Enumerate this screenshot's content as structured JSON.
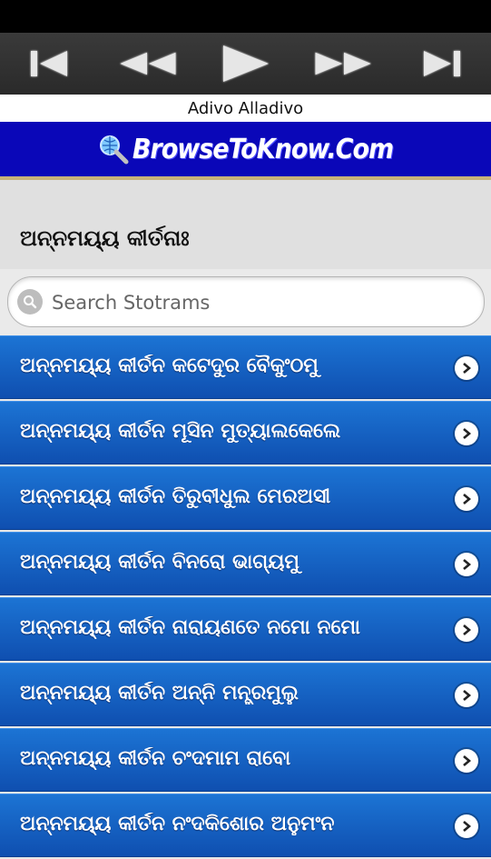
{
  "media_controls": [
    {
      "name": "skip-back-icon"
    },
    {
      "name": "rewind-icon"
    },
    {
      "name": "play-icon"
    },
    {
      "name": "fast-forward-icon"
    },
    {
      "name": "skip-forward-icon"
    }
  ],
  "now_playing": {
    "title": "Adivo Alladivo"
  },
  "banner": {
    "text": "BrowseToKnow.Com",
    "icon": "globe-magnifier-icon"
  },
  "page": {
    "title": "ଅନ୍ନମୟ୍ୟ କୀର୍ତନାଃ"
  },
  "search": {
    "placeholder": "Search Stotrams",
    "value": ""
  },
  "list": {
    "items": [
      {
        "label": "ଅନ୍ନମୟ୍ୟ କୀର୍ତନ କଟେଦୁର ବୈକୁଂଠମୁ"
      },
      {
        "label": "ଅନ୍ନମୟ୍ୟ କୀର୍ତନ ମୂସିନ ମୁତ୍ୟାଲକେଲେ"
      },
      {
        "label": "ଅନ୍ନମୟ୍ୟ କୀର୍ତନ ତିରୁବୀଧୁଲ ମେରଅସୀ"
      },
      {
        "label": "ଅନ୍ନମୟ୍ୟ କୀର୍ତନ ବିନରୋ ଭାଗ୍ୟମୁ"
      },
      {
        "label": "ଅନ୍ନମୟ୍ୟ କୀର୍ତନ ନାରାୟଣତେ ନମୋ ନମୋ"
      },
      {
        "label": "ଅନ୍ନମୟ୍ୟ କୀର୍ତନ ଅନ୍ନି ମନ୍ତ୍ରମୁଲୁ"
      },
      {
        "label": "ଅନ୍ନମୟ୍ୟ କୀର୍ତନ ଚଂଦମାମ ରାବୋ"
      },
      {
        "label": "ଅନ୍ନମୟ୍ୟ କୀର୍ତନ ନଂଦକିଶୋର ଅନୁମଂନ"
      }
    ]
  },
  "colors": {
    "accent_blue": "#0f4fb0",
    "banner_blue": "#0a07b8"
  }
}
